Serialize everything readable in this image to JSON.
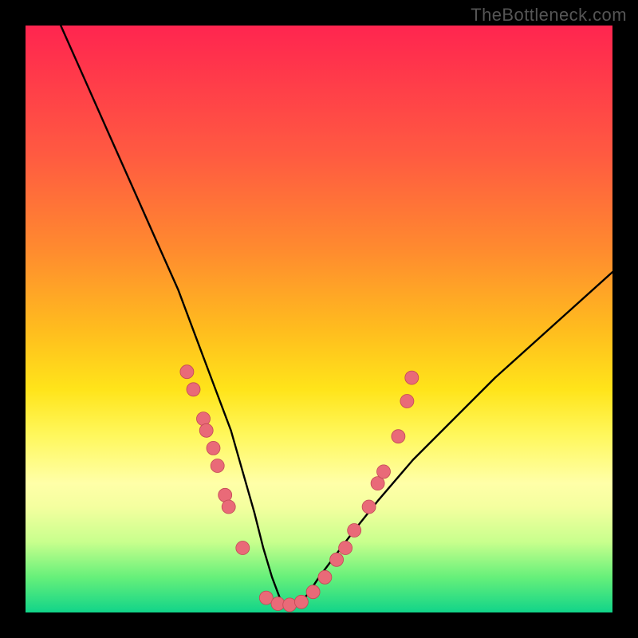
{
  "watermark": "TheBottleneck.com",
  "colors": {
    "frame": "#000000",
    "curve": "#000000",
    "marker_fill": "#e96a78",
    "marker_stroke": "#c24955"
  },
  "chart_data": {
    "type": "line",
    "title": "",
    "xlabel": "",
    "ylabel": "",
    "x_range": [
      0,
      100
    ],
    "y_range": [
      0,
      100
    ],
    "description": "V-shaped bottleneck curve with minimum near x≈43 over a red-to-green vertical gradient background. Pink markers cluster along the lower portion of both arms of the V.",
    "series": [
      {
        "name": "bottleneck-curve",
        "x": [
          6,
          10,
          14,
          18,
          22,
          26,
          29,
          32,
          35,
          37,
          39,
          40.5,
          42,
          43.5,
          45,
          46.5,
          48,
          50,
          53,
          56,
          60,
          66,
          72,
          80,
          90,
          100
        ],
        "y": [
          100,
          91,
          82,
          73,
          64,
          55,
          47,
          39,
          31,
          24,
          17,
          11,
          6,
          2,
          1,
          1.5,
          3,
          6,
          10,
          14,
          19,
          26,
          32,
          40,
          49,
          58
        ]
      }
    ],
    "markers": [
      {
        "x": 27.5,
        "y": 41
      },
      {
        "x": 28.6,
        "y": 38
      },
      {
        "x": 30.3,
        "y": 33
      },
      {
        "x": 30.8,
        "y": 31
      },
      {
        "x": 32.0,
        "y": 28
      },
      {
        "x": 32.7,
        "y": 25
      },
      {
        "x": 34.0,
        "y": 20
      },
      {
        "x": 34.6,
        "y": 18
      },
      {
        "x": 37.0,
        "y": 11
      },
      {
        "x": 41.0,
        "y": 2.5
      },
      {
        "x": 43.0,
        "y": 1.5
      },
      {
        "x": 45.0,
        "y": 1.3
      },
      {
        "x": 47.0,
        "y": 1.8
      },
      {
        "x": 49.0,
        "y": 3.5
      },
      {
        "x": 51.0,
        "y": 6
      },
      {
        "x": 53.0,
        "y": 9
      },
      {
        "x": 54.5,
        "y": 11
      },
      {
        "x": 56.0,
        "y": 14
      },
      {
        "x": 58.5,
        "y": 18
      },
      {
        "x": 60.0,
        "y": 22
      },
      {
        "x": 61.0,
        "y": 24
      },
      {
        "x": 63.5,
        "y": 30
      },
      {
        "x": 65.0,
        "y": 36
      },
      {
        "x": 65.8,
        "y": 40
      }
    ],
    "gradient_stops": [
      {
        "pos": 0,
        "color": "#ff2851"
      },
      {
        "pos": 38,
        "color": "#ff8a2f"
      },
      {
        "pos": 62,
        "color": "#ffe41a"
      },
      {
        "pos": 82,
        "color": "#f4ff9f"
      },
      {
        "pos": 100,
        "color": "#11d489"
      }
    ]
  }
}
